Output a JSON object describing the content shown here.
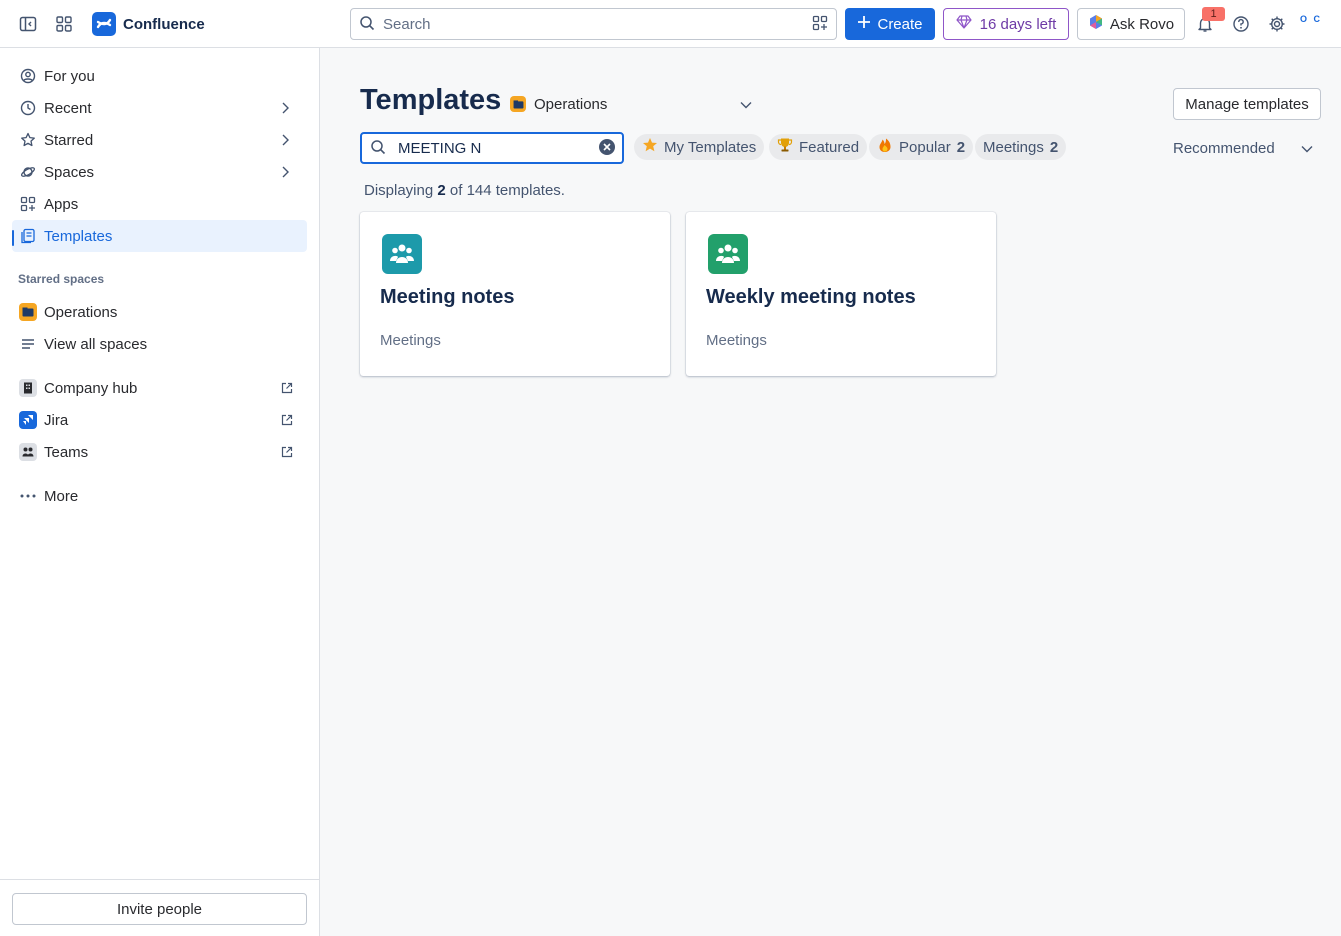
{
  "app": {
    "name": "Confluence",
    "search_placeholder": "Search",
    "create_label": "Create",
    "trial_label": "16 days left",
    "rovo_label": "Ask Rovo",
    "notification_count": "1",
    "avatar_text": "O C"
  },
  "sidebar": {
    "items": [
      {
        "label": "For you"
      },
      {
        "label": "Recent"
      },
      {
        "label": "Starred"
      },
      {
        "label": "Spaces"
      },
      {
        "label": "Apps"
      },
      {
        "label": "Templates"
      }
    ],
    "starred_title": "Starred spaces",
    "starred_items": [
      {
        "label": "Operations"
      },
      {
        "label": "View all spaces"
      }
    ],
    "external_items": [
      {
        "label": "Company hub"
      },
      {
        "label": "Jira"
      },
      {
        "label": "Teams"
      }
    ],
    "more_label": "More",
    "invite_label": "Invite people"
  },
  "main": {
    "title": "Templates",
    "space": "Operations",
    "manage_label": "Manage templates",
    "search_value": "MEETING N",
    "chips": [
      {
        "label": "My Templates",
        "count": ""
      },
      {
        "label": "Featured",
        "count": ""
      },
      {
        "label": "Popular",
        "count": "2"
      },
      {
        "label": "Meetings",
        "count": "2"
      }
    ],
    "sort_label": "Recommended",
    "count_prefix": "Displaying",
    "count_shown": "2",
    "count_suffix": "of 144 templates.",
    "cards": [
      {
        "title": "Meeting notes",
        "category": "Meetings",
        "color": "#1d9aaa"
      },
      {
        "title": "Weekly meeting notes",
        "category": "Meetings",
        "color": "#22a06b"
      }
    ]
  },
  "colors": {
    "accent": "#1868db",
    "trial": "#8f56c8",
    "badge": "#f87168"
  }
}
